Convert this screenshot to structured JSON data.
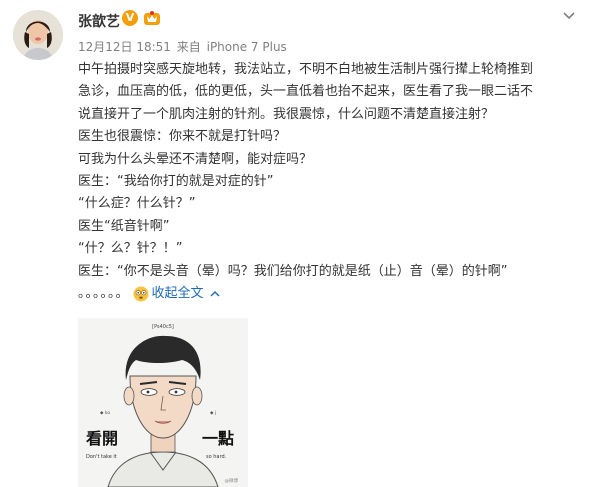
{
  "post": {
    "author": "张歆艺",
    "verified_badge": "V",
    "timestamp": "12月12日 18:51",
    "source_prefix": "来自",
    "source": "iPhone 7 Plus",
    "lines": [
      "中午拍摄时突感天旋地转，我法站立，不明不白地被生活制片强行撵上轮椅推到",
      "急诊，血压高的低，低的更低，头一直低着也抬不起来，医生看了我一眼二话不",
      "说直接开了一个肌肉注射的针剂。我很震惊，什么问题不清楚直接注射？",
      "医生也很震惊：你来不就是打针吗？",
      "可我为什么头晕还不清楚啊，能对症吗？",
      "医生：“我给你打的就是对症的针”",
      "“什么症？什么针？”",
      "医生“纸音针啊”",
      "“什？么？针？！”",
      "医生：“你不是头音（晕）吗？我们给你打的就是纸（止）音（晕）的针啊”"
    ],
    "trailing_dots": "。。。。。。",
    "collapse_label": "收起全文",
    "image": {
      "top_label": "[Ps40c5]",
      "left_title": "看開",
      "right_title": "一點",
      "left_caption": "Don't take it",
      "right_caption": "so hard.",
      "left_small": "◆ ko",
      "right_small": "◆ j",
      "watermark": "@微博"
    }
  },
  "colors": {
    "link": "#1c6ab7",
    "meta": "#808080",
    "text": "#333333",
    "badge": "#f59e0b"
  }
}
